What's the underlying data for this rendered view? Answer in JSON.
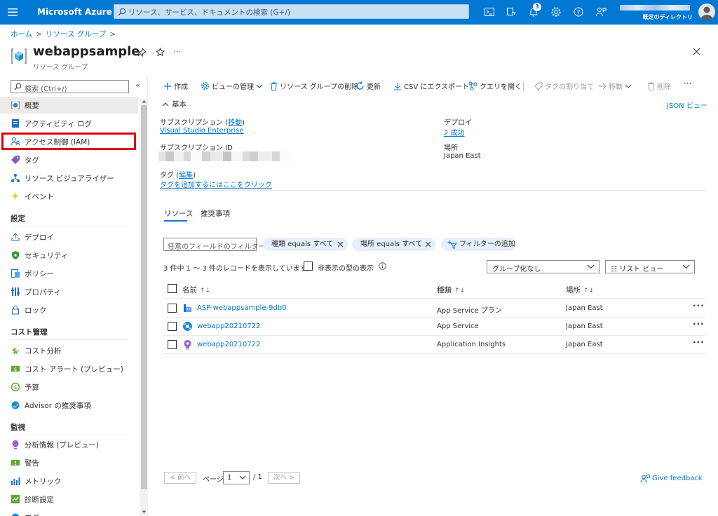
{
  "topbar": {
    "brand": "Microsoft Azure",
    "search_placeholder": "リソース、サービス、ドキュメントの検索 (G+/)",
    "notification_count": "3",
    "directory_label": "既定のディレクトリ",
    "accent": "#0078d4"
  },
  "breadcrumb": {
    "home": "ホーム",
    "resource_groups": "リソース グループ"
  },
  "header": {
    "title": "webappsample",
    "subtitle": "リソース グループ",
    "more": "···"
  },
  "sidebar": {
    "search_placeholder": "検索 (Ctrl+/)",
    "collapse": "«",
    "items_top": [
      {
        "label": "概要",
        "icon": "resource-group-icon"
      },
      {
        "label": "アクティビティ ログ",
        "icon": "activity-log-icon"
      },
      {
        "label": "アクセス制御 (IAM)",
        "icon": "iam-icon"
      },
      {
        "label": "タグ",
        "icon": "tag-icon"
      },
      {
        "label": "リソース ビジュアライザー",
        "icon": "visualizer-icon"
      },
      {
        "label": "イベント",
        "icon": "events-icon"
      }
    ],
    "section_settings": "設定",
    "items_settings": [
      {
        "label": "デプロイ",
        "icon": "deploy-icon"
      },
      {
        "label": "セキュリティ",
        "icon": "security-icon"
      },
      {
        "label": "ポリシー",
        "icon": "policy-icon"
      },
      {
        "label": "プロパティ",
        "icon": "properties-icon"
      },
      {
        "label": "ロック",
        "icon": "lock-icon"
      }
    ],
    "section_cost": "コスト管理",
    "items_cost": [
      {
        "label": "コスト分析",
        "icon": "cost-analysis-icon"
      },
      {
        "label": "コスト アラート (プレビュー)",
        "icon": "cost-alert-icon"
      },
      {
        "label": "予算",
        "icon": "budget-icon"
      },
      {
        "label": "Advisor の推奨事項",
        "icon": "advisor-icon"
      }
    ],
    "section_monitor": "監視",
    "items_monitor": [
      {
        "label": "分析情報 (プレビュー)",
        "icon": "insights-icon"
      },
      {
        "label": "警告",
        "icon": "alerts-icon"
      },
      {
        "label": "メトリック",
        "icon": "metrics-icon"
      },
      {
        "label": "診断設定",
        "icon": "diagnostics-icon"
      },
      {
        "label": "ログ",
        "icon": "logs-icon"
      }
    ]
  },
  "toolbar": {
    "create": "作成",
    "manage_view": "ビューの管理",
    "delete_group": "リソース グループの削除",
    "refresh": "更新",
    "export_csv": "CSV にエクスポート",
    "open_query": "クエリを開く",
    "assign_tags": "タグの割り当て",
    "move": "移動",
    "delete": "削除",
    "more": "···"
  },
  "essentials": {
    "heading": "基本",
    "json_view": "JSON ビュー",
    "subscription_label": "サブスクリプション",
    "subscription_move": "移動",
    "subscription_value": "Visual Studio Enterprise",
    "subscription_id_label": "サブスクリプション ID",
    "tags_label": "タグ",
    "tags_edit": "編集",
    "tags_add_link": "タグを追加するにはここをクリック",
    "deploy_label": "デプロイ",
    "deploy_value": "2 成功",
    "location_label": "場所",
    "location_value": "Japan East"
  },
  "tabs": {
    "resources": "リソース",
    "recommendations": "推奨事項"
  },
  "filter": {
    "placeholder": "任意のフィールドのフィルター...",
    "pill_type": "種類 equals すべて",
    "pill_location": "場所 equals すべて",
    "add_filter": "フィルターの追加"
  },
  "list": {
    "count_text": "3 件中 1 ～ 3 件のレコードを表示しています。",
    "show_hidden": "非表示の型の表示",
    "grouping": "グループ化なし",
    "view_mode": "リスト ビュー",
    "columns": {
      "name": "名前",
      "type": "種類",
      "location": "場所",
      "sort": "↑↓"
    },
    "rows": [
      {
        "name": "ASP-webappsample-9db0",
        "type": "App Service プラン",
        "location": "Japan East",
        "icon": "app-service-plan-icon",
        "more": "···"
      },
      {
        "name": "webapp20210722",
        "type": "App Service",
        "location": "Japan East",
        "icon": "app-service-icon",
        "more": "···"
      },
      {
        "name": "webapp20210722",
        "type": "Application Insights",
        "location": "Japan East",
        "icon": "app-insights-icon",
        "more": "···"
      }
    ]
  },
  "pager": {
    "prev": "< 前へ",
    "page_label": "ページ",
    "page": "1",
    "total": "/ 1",
    "next": "次へ >"
  },
  "feedback": "Give feedback",
  "highlight_color": "#e00000"
}
